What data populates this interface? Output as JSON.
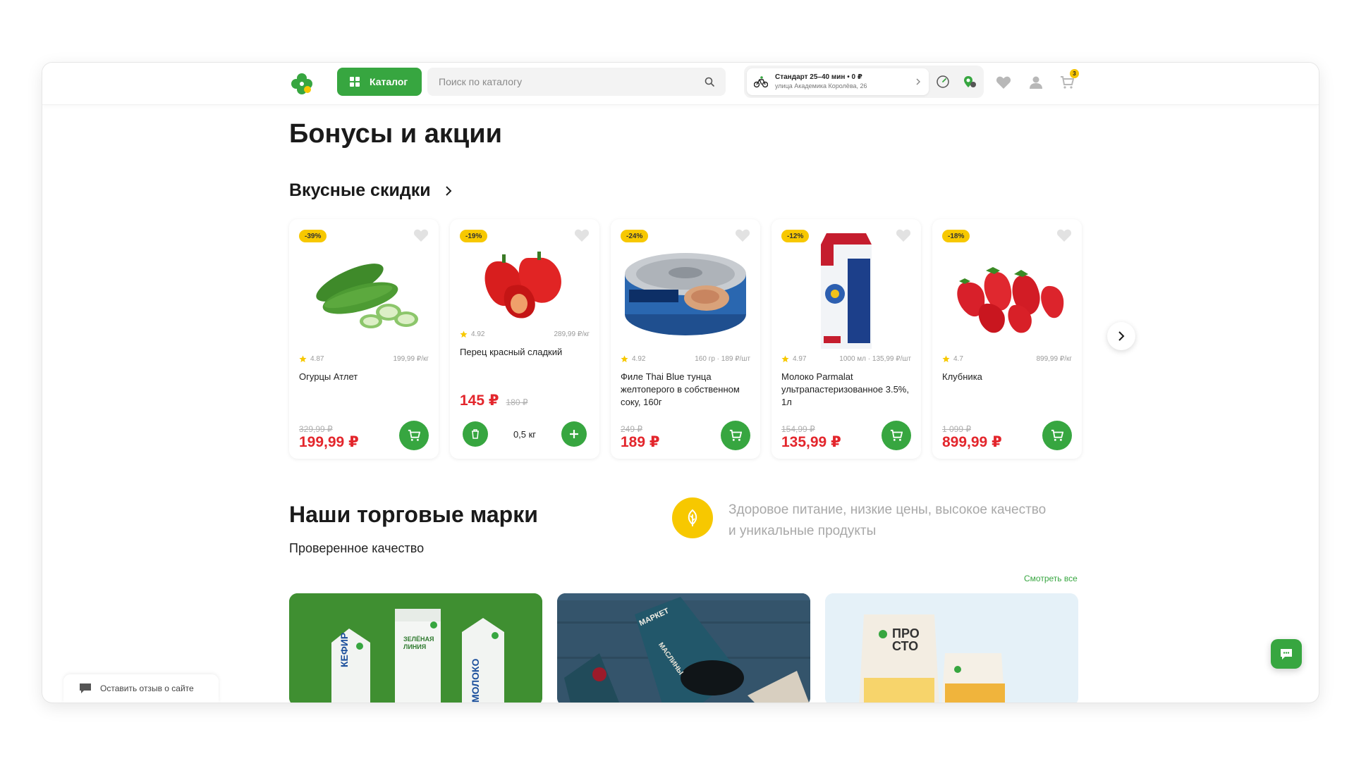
{
  "header": {
    "catalog_label": "Каталог",
    "search_placeholder": "Поиск по каталогу",
    "delivery_line1": "Стандарт 25–40 мин  •  0 ₽",
    "delivery_line2": "улица Академика Королёва, 26",
    "cart_count": "3"
  },
  "page_title": "Бонусы и акции",
  "discounts": {
    "title": "Вкусные скидки",
    "products": [
      {
        "badge": "-39%",
        "rating": "4.87",
        "unit": "199,99 ₽/кг",
        "name": "Огурцы Атлет",
        "old_price": "329,99 ₽",
        "price": "199,99 ₽"
      },
      {
        "badge": "-19%",
        "rating": "4.92",
        "unit": "289,99 ₽/кг",
        "name": "Перец красный сладкий",
        "price": "145 ₽",
        "old_price": "180 ₽",
        "qty": "0,5  кг"
      },
      {
        "badge": "-24%",
        "rating": "4.92",
        "unit": "160 гр · 189 ₽/шт",
        "name": "Филе Thai Blue тунца желтоперого в собственном соку, 160г",
        "old_price": "249 ₽",
        "price": "189 ₽"
      },
      {
        "badge": "-12%",
        "rating": "4.97",
        "unit": "1000 мл · 135,99 ₽/шт",
        "name": "Молоко Parmalat ультрапастеризованное 3.5%, 1л",
        "old_price": "154,99 ₽",
        "price": "135,99 ₽"
      },
      {
        "badge": "-18%",
        "rating": "4.7",
        "unit": "899,99 ₽/кг",
        "name": "Клубника",
        "old_price": "1 099 ₽",
        "price": "899,99 ₽"
      }
    ]
  },
  "brands": {
    "title": "Наши торговые марки",
    "subtitle": "Проверенное качество",
    "description": "Здоровое питание, низкие цены, высокое качество и уникальные продукты",
    "see_all": "Смотреть все",
    "card1": {
      "label1": "КЕФИР",
      "label2": "ЗЕЛЁНАЯ ЛИНИЯ",
      "label3": "МОЛОКО"
    },
    "card2": {
      "label1": "МАРКЕТ",
      "label2": "МАСЛИНЫ"
    },
    "card3": {
      "label1": "ПРО СТО"
    }
  },
  "feedback_label": "Оставить отзыв о сайте",
  "colors": {
    "brand_green": "#37a640",
    "badge_yellow": "#f7c800",
    "price_red": "#e3262c"
  }
}
